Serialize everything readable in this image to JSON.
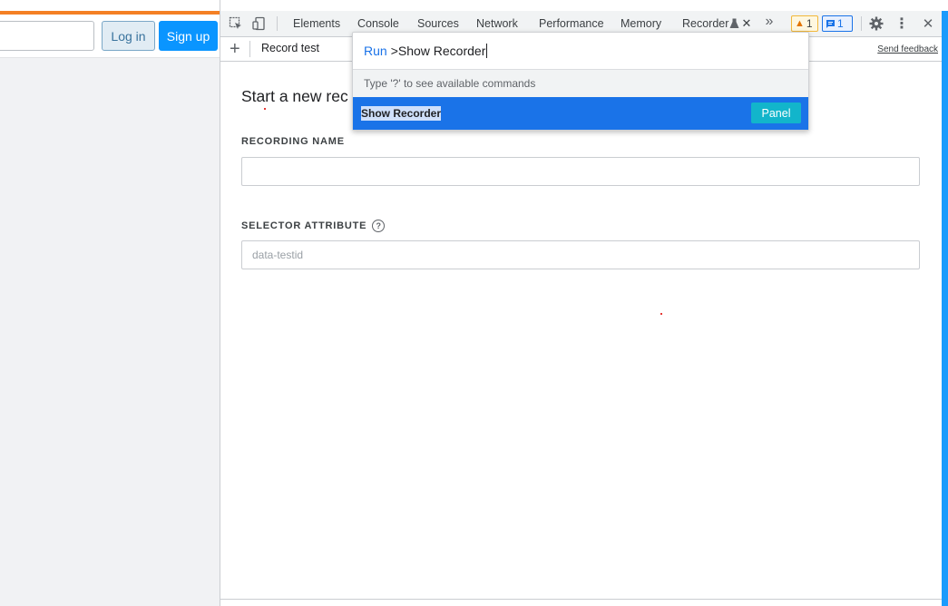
{
  "page": {
    "login_label": "Log in",
    "signup_label": "Sign up"
  },
  "devtools": {
    "tabs": [
      "Elements",
      "Console",
      "Sources",
      "Network",
      "Performance",
      "Memory",
      "Recorder"
    ],
    "warnings_count": "1",
    "messages_count": "1",
    "more_tabs_glyph": "»"
  },
  "toolbar": {
    "record_test_label": "Record test",
    "send_feedback_label": "Send feedback"
  },
  "recorder": {
    "heading": "Start a new rec",
    "recording_name_label": "RECORDING NAME",
    "recording_name_value": "",
    "selector_attribute_label": "SELECTOR ATTRIBUTE",
    "selector_attribute_placeholder": "data-testid"
  },
  "command_menu": {
    "prefix": "Run",
    "query": ">Show Recorder",
    "hint": "Type '?' to see available commands",
    "items": [
      {
        "label": "Show Recorder",
        "badge": "Panel"
      }
    ]
  },
  "colors": {
    "accent": "#1a73e8",
    "panel_badge": "#12b5cb",
    "stack_orange": "#f48024",
    "signup_blue": "#0a95ff"
  }
}
